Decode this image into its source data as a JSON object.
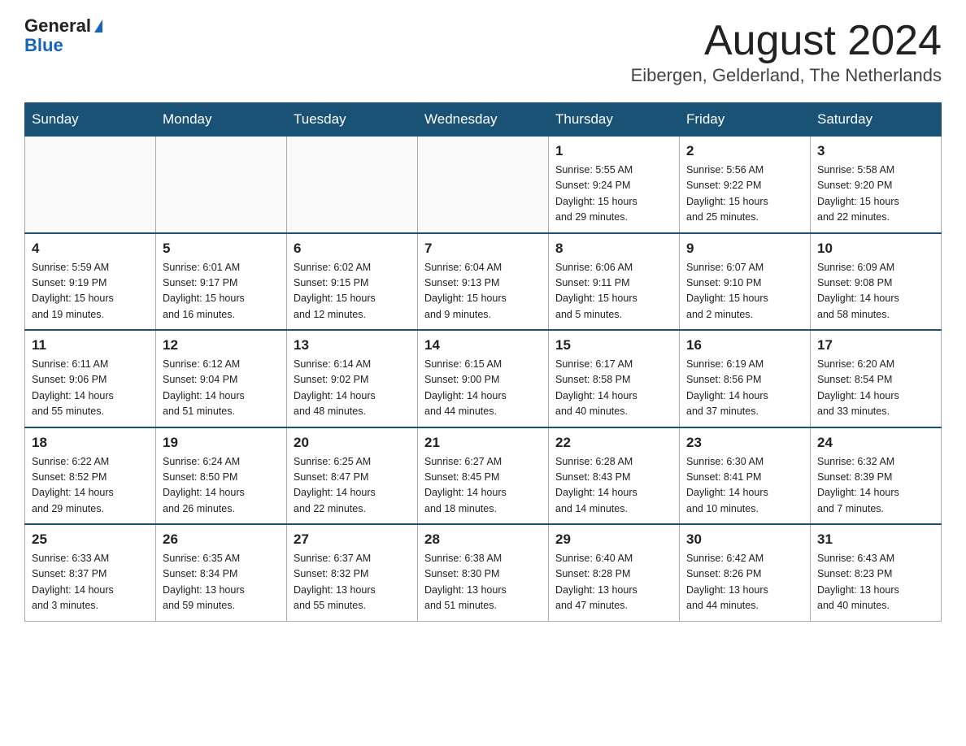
{
  "logo": {
    "general": "General",
    "blue": "Blue"
  },
  "header": {
    "month": "August 2024",
    "location": "Eibergen, Gelderland, The Netherlands"
  },
  "weekdays": [
    "Sunday",
    "Monday",
    "Tuesday",
    "Wednesday",
    "Thursday",
    "Friday",
    "Saturday"
  ],
  "weeks": [
    [
      {
        "day": "",
        "info": ""
      },
      {
        "day": "",
        "info": ""
      },
      {
        "day": "",
        "info": ""
      },
      {
        "day": "",
        "info": ""
      },
      {
        "day": "1",
        "info": "Sunrise: 5:55 AM\nSunset: 9:24 PM\nDaylight: 15 hours\nand 29 minutes."
      },
      {
        "day": "2",
        "info": "Sunrise: 5:56 AM\nSunset: 9:22 PM\nDaylight: 15 hours\nand 25 minutes."
      },
      {
        "day": "3",
        "info": "Sunrise: 5:58 AM\nSunset: 9:20 PM\nDaylight: 15 hours\nand 22 minutes."
      }
    ],
    [
      {
        "day": "4",
        "info": "Sunrise: 5:59 AM\nSunset: 9:19 PM\nDaylight: 15 hours\nand 19 minutes."
      },
      {
        "day": "5",
        "info": "Sunrise: 6:01 AM\nSunset: 9:17 PM\nDaylight: 15 hours\nand 16 minutes."
      },
      {
        "day": "6",
        "info": "Sunrise: 6:02 AM\nSunset: 9:15 PM\nDaylight: 15 hours\nand 12 minutes."
      },
      {
        "day": "7",
        "info": "Sunrise: 6:04 AM\nSunset: 9:13 PM\nDaylight: 15 hours\nand 9 minutes."
      },
      {
        "day": "8",
        "info": "Sunrise: 6:06 AM\nSunset: 9:11 PM\nDaylight: 15 hours\nand 5 minutes."
      },
      {
        "day": "9",
        "info": "Sunrise: 6:07 AM\nSunset: 9:10 PM\nDaylight: 15 hours\nand 2 minutes."
      },
      {
        "day": "10",
        "info": "Sunrise: 6:09 AM\nSunset: 9:08 PM\nDaylight: 14 hours\nand 58 minutes."
      }
    ],
    [
      {
        "day": "11",
        "info": "Sunrise: 6:11 AM\nSunset: 9:06 PM\nDaylight: 14 hours\nand 55 minutes."
      },
      {
        "day": "12",
        "info": "Sunrise: 6:12 AM\nSunset: 9:04 PM\nDaylight: 14 hours\nand 51 minutes."
      },
      {
        "day": "13",
        "info": "Sunrise: 6:14 AM\nSunset: 9:02 PM\nDaylight: 14 hours\nand 48 minutes."
      },
      {
        "day": "14",
        "info": "Sunrise: 6:15 AM\nSunset: 9:00 PM\nDaylight: 14 hours\nand 44 minutes."
      },
      {
        "day": "15",
        "info": "Sunrise: 6:17 AM\nSunset: 8:58 PM\nDaylight: 14 hours\nand 40 minutes."
      },
      {
        "day": "16",
        "info": "Sunrise: 6:19 AM\nSunset: 8:56 PM\nDaylight: 14 hours\nand 37 minutes."
      },
      {
        "day": "17",
        "info": "Sunrise: 6:20 AM\nSunset: 8:54 PM\nDaylight: 14 hours\nand 33 minutes."
      }
    ],
    [
      {
        "day": "18",
        "info": "Sunrise: 6:22 AM\nSunset: 8:52 PM\nDaylight: 14 hours\nand 29 minutes."
      },
      {
        "day": "19",
        "info": "Sunrise: 6:24 AM\nSunset: 8:50 PM\nDaylight: 14 hours\nand 26 minutes."
      },
      {
        "day": "20",
        "info": "Sunrise: 6:25 AM\nSunset: 8:47 PM\nDaylight: 14 hours\nand 22 minutes."
      },
      {
        "day": "21",
        "info": "Sunrise: 6:27 AM\nSunset: 8:45 PM\nDaylight: 14 hours\nand 18 minutes."
      },
      {
        "day": "22",
        "info": "Sunrise: 6:28 AM\nSunset: 8:43 PM\nDaylight: 14 hours\nand 14 minutes."
      },
      {
        "day": "23",
        "info": "Sunrise: 6:30 AM\nSunset: 8:41 PM\nDaylight: 14 hours\nand 10 minutes."
      },
      {
        "day": "24",
        "info": "Sunrise: 6:32 AM\nSunset: 8:39 PM\nDaylight: 14 hours\nand 7 minutes."
      }
    ],
    [
      {
        "day": "25",
        "info": "Sunrise: 6:33 AM\nSunset: 8:37 PM\nDaylight: 14 hours\nand 3 minutes."
      },
      {
        "day": "26",
        "info": "Sunrise: 6:35 AM\nSunset: 8:34 PM\nDaylight: 13 hours\nand 59 minutes."
      },
      {
        "day": "27",
        "info": "Sunrise: 6:37 AM\nSunset: 8:32 PM\nDaylight: 13 hours\nand 55 minutes."
      },
      {
        "day": "28",
        "info": "Sunrise: 6:38 AM\nSunset: 8:30 PM\nDaylight: 13 hours\nand 51 minutes."
      },
      {
        "day": "29",
        "info": "Sunrise: 6:40 AM\nSunset: 8:28 PM\nDaylight: 13 hours\nand 47 minutes."
      },
      {
        "day": "30",
        "info": "Sunrise: 6:42 AM\nSunset: 8:26 PM\nDaylight: 13 hours\nand 44 minutes."
      },
      {
        "day": "31",
        "info": "Sunrise: 6:43 AM\nSunset: 8:23 PM\nDaylight: 13 hours\nand 40 minutes."
      }
    ]
  ]
}
